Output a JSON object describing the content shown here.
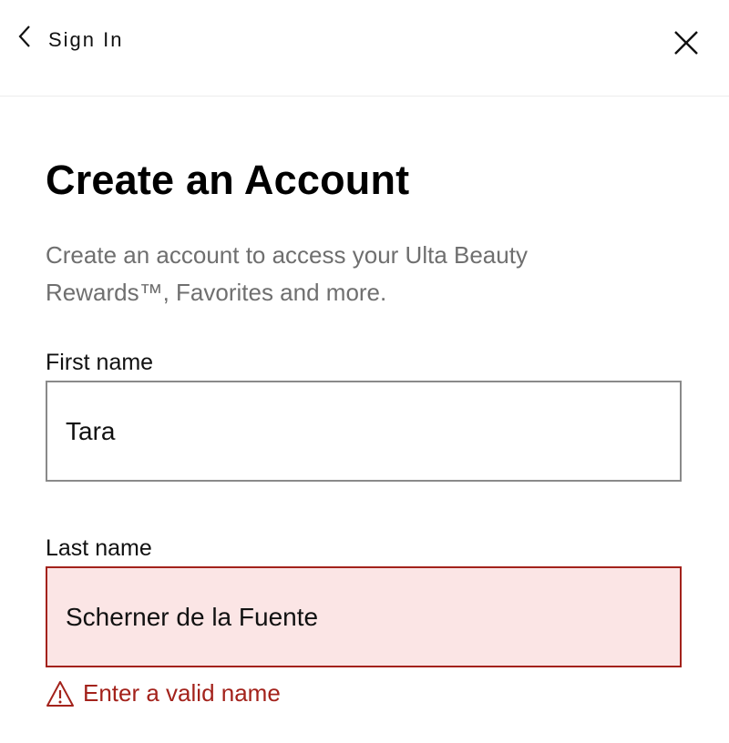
{
  "header": {
    "back_label": "Sign In",
    "back_icon": "chevron-left-icon",
    "close_icon": "close-icon"
  },
  "main": {
    "title": "Create an Account",
    "subtitle": "Create an account to access your Ulta Beauty Rewards™, Favorites and more."
  },
  "form": {
    "first_name": {
      "label": "First name",
      "value": "Tara"
    },
    "last_name": {
      "label": "Last name",
      "value": "Scherner de la Fuente",
      "error": "Enter a valid name",
      "error_icon": "warning-icon"
    }
  },
  "colors": {
    "error": "#a3221b",
    "error_background": "#fbe5e5",
    "subtitle_text": "#6f6f6f",
    "field_border": "#8a8a8a"
  }
}
